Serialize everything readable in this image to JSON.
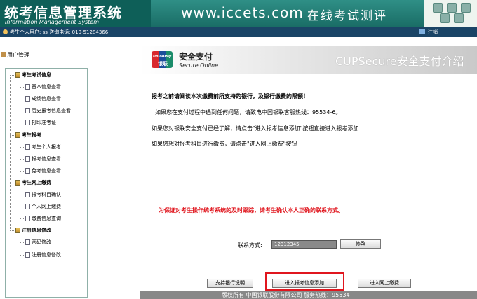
{
  "header": {
    "title": "统考信息管理系统",
    "subtitle": "Information Management System",
    "url": "www.iccets.com",
    "slogan": "在线考试测评"
  },
  "infobar": {
    "user_text": "考生个人用户: ss 咨询电话: 010-51284366",
    "logout_label": "注销"
  },
  "sidebar": {
    "title": "用户管理",
    "menu": [
      {
        "label": "考生考试信息",
        "type": "group"
      },
      {
        "label": "基本信息查看",
        "type": "leaf"
      },
      {
        "label": "成绩信息查看",
        "type": "leaf"
      },
      {
        "label": "历史报考信息查看",
        "type": "leaf"
      },
      {
        "label": "打印准考证",
        "type": "leaf"
      },
      {
        "label": "考生报考",
        "type": "group"
      },
      {
        "label": "考生个人报考",
        "type": "leaf"
      },
      {
        "label": "报考信息查看",
        "type": "leaf"
      },
      {
        "label": "免考信息查看",
        "type": "leaf"
      },
      {
        "label": "考生网上缴费",
        "type": "group"
      },
      {
        "label": "报考科目确认",
        "type": "leaf"
      },
      {
        "label": "个人网上缴费",
        "type": "leaf"
      },
      {
        "label": "缴费信息查询",
        "type": "leaf"
      },
      {
        "label": "注册信息修改",
        "type": "group"
      },
      {
        "label": "密码修改",
        "type": "leaf"
      },
      {
        "label": "注册信息修改",
        "type": "leaf"
      }
    ]
  },
  "banner": {
    "logo_text_top": "UnionPay",
    "logo_text_bottom": "银联",
    "secure_title": "安全支付",
    "secure_sub": "Secure Online",
    "cups_title": "CUPSecure安全支付介绍"
  },
  "main": {
    "notice1": "报考之前请阅读本次缴费前所支持的银行，及银行缴费的限额！",
    "notice2": "如果您在支付过程中遇到任何问题，请致电中国银联客服热线：95534-6。",
    "notice3": "如果您对银联安全支付已经了解，请点击\"进入报考信息添加\"按钮直接进入报考添加",
    "notice4": "如果您想对报考科目进行缴费，请点击\"进入网上缴费\"按钮",
    "warning": "为保证对考生操作统考系统的及时跟踪，请考生确认本人正确的联系方式。",
    "contact_label": "联系方式:",
    "contact_value": "12312345",
    "modify_btn": "修改",
    "banks_btn": "支持银行说明",
    "add_btn": "进入报考信息添加",
    "pay_btn": "进入网上缴费"
  },
  "footer": {
    "text": "版权所有  中国银联股份有限公司        服务热线：95534"
  },
  "colors": {
    "header_teal": "#1a6d66",
    "infobar_blue": "#1a4466",
    "warning_red": "#e0161e",
    "highlight_red": "#e0161e"
  }
}
